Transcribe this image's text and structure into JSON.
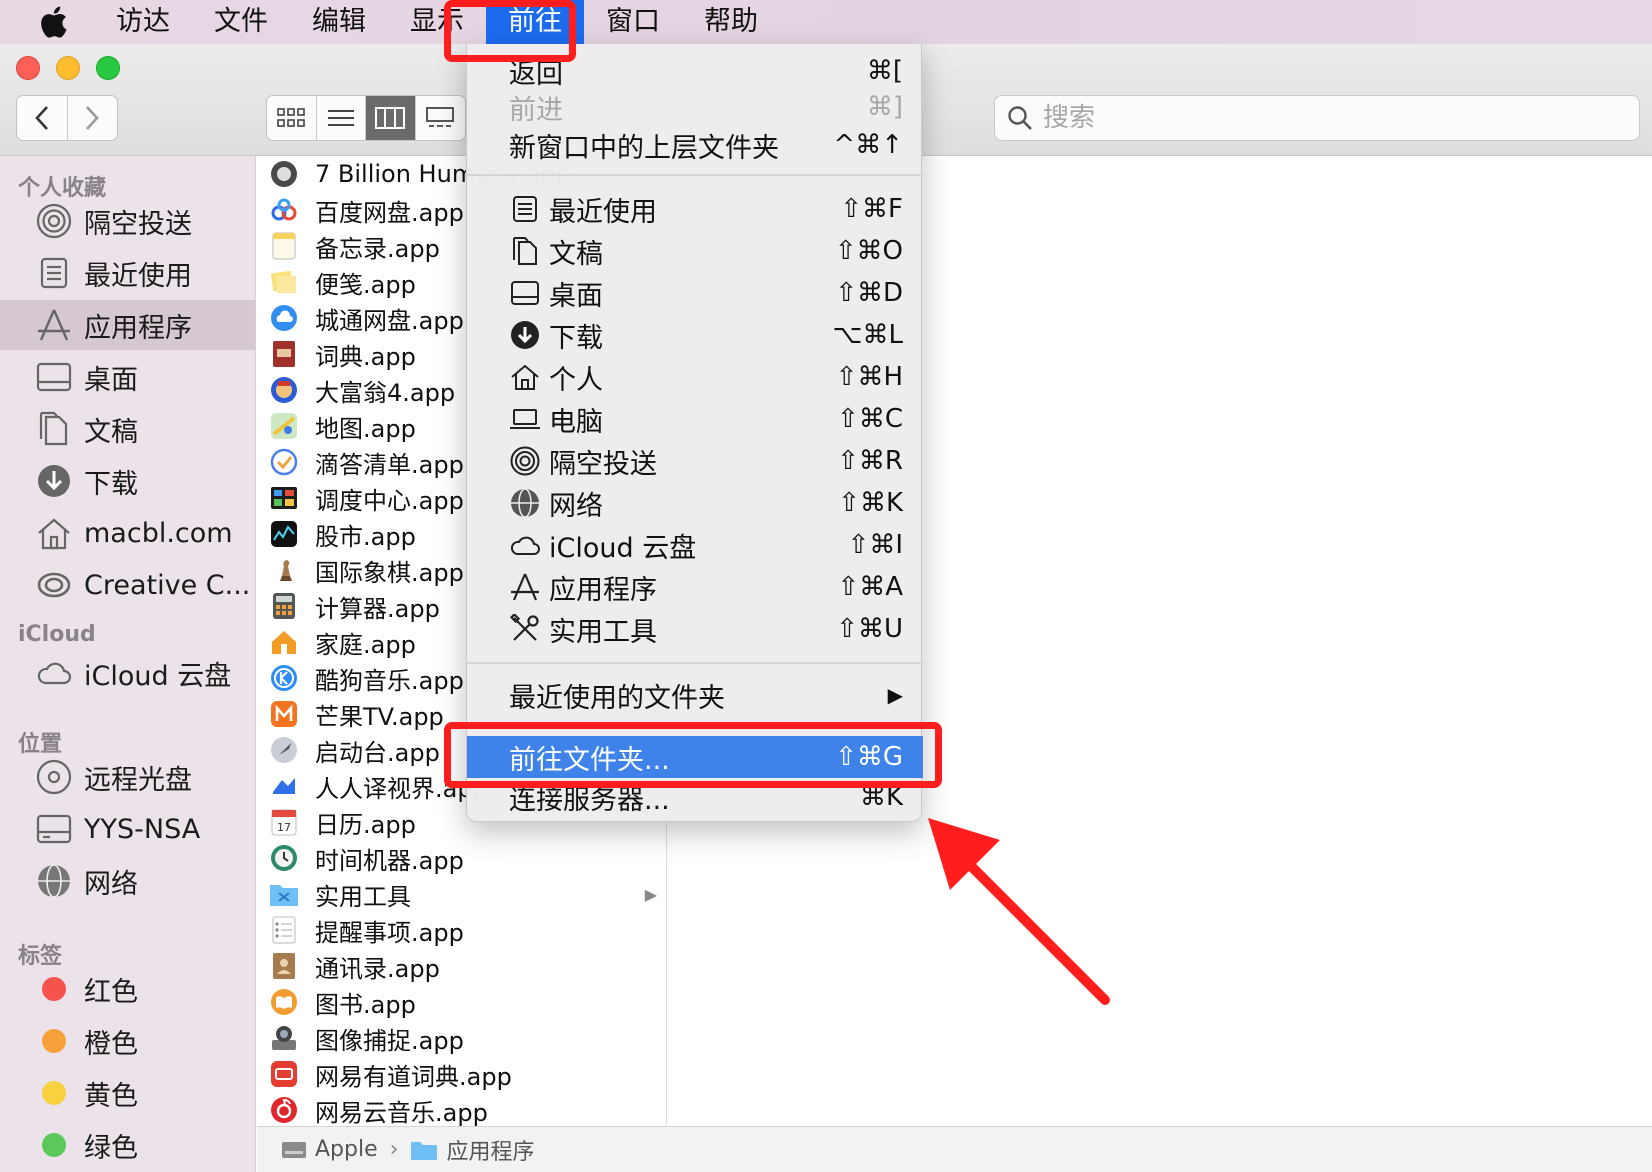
{
  "menubar": {
    "items": [
      "访达",
      "文件",
      "编辑",
      "显示",
      "前往",
      "窗口",
      "帮助"
    ],
    "active": "前往"
  },
  "search": {
    "placeholder": "搜索"
  },
  "sidebar": {
    "favorites_header": "个人收藏",
    "favorites": [
      "隔空投送",
      "最近使用",
      "应用程序",
      "桌面",
      "文稿",
      "下载",
      "macbl.com",
      "Creative C..."
    ],
    "icloud_header": "iCloud",
    "icloud": [
      "iCloud 云盘"
    ],
    "locations_header": "位置",
    "locations": [
      "远程光盘",
      "YYS-NSA",
      "网络"
    ],
    "tags_header": "标签",
    "tags": [
      {
        "label": "红色",
        "color": "#f5534b"
      },
      {
        "label": "橙色",
        "color": "#f7a13b"
      },
      {
        "label": "黄色",
        "color": "#f7d23e"
      },
      {
        "label": "绿色",
        "color": "#5bc85a"
      }
    ]
  },
  "files": [
    "7 Billion Humans.app",
    "百度网盘.app",
    "备忘录.app",
    "便笺.app",
    "城通网盘.app",
    "词典.app",
    "大富翁4.app",
    "地图.app",
    "滴答清单.app",
    "调度中心.app",
    "股市.app",
    "国际象棋.app",
    "计算器.app",
    "家庭.app",
    "酷狗音乐.app",
    "芒果TV.app",
    "启动台.app",
    "人人译视界.app",
    "日历.app",
    "时间机器.app",
    "实用工具",
    "提醒事项.app",
    "通讯录.app",
    "图书.app",
    "图像捕捉.app",
    "网易有道词典.app",
    "网易云音乐.app"
  ],
  "pathbar": {
    "root": "Apple",
    "sep": "›",
    "current": "应用程序"
  },
  "go_menu": {
    "back": {
      "label": "返回",
      "shortcut": "⌘["
    },
    "forward": {
      "label": "前进",
      "shortcut": "⌘]"
    },
    "enclosing": {
      "label": "新窗口中的上层文件夹",
      "shortcut": "^⌘↑"
    },
    "places": [
      {
        "label": "最近使用",
        "shortcut": "⇧⌘F",
        "icon": "recents-icon"
      },
      {
        "label": "文稿",
        "shortcut": "⇧⌘O",
        "icon": "documents-icon"
      },
      {
        "label": "桌面",
        "shortcut": "⇧⌘D",
        "icon": "desktop-icon"
      },
      {
        "label": "下载",
        "shortcut": "⌥⌘L",
        "icon": "downloads-icon"
      },
      {
        "label": "个人",
        "shortcut": "⇧⌘H",
        "icon": "home-icon"
      },
      {
        "label": "电脑",
        "shortcut": "⇧⌘C",
        "icon": "computer-icon"
      },
      {
        "label": "隔空投送",
        "shortcut": "⇧⌘R",
        "icon": "airdrop-icon"
      },
      {
        "label": "网络",
        "shortcut": "⇧⌘K",
        "icon": "network-icon"
      },
      {
        "label": "iCloud 云盘",
        "shortcut": "⇧⌘I",
        "icon": "cloud-icon"
      },
      {
        "label": "应用程序",
        "shortcut": "⇧⌘A",
        "icon": "applications-icon"
      },
      {
        "label": "实用工具",
        "shortcut": "⇧⌘U",
        "icon": "utilities-icon"
      }
    ],
    "recent_folders": {
      "label": "最近使用的文件夹",
      "shortcut": "▶"
    },
    "go_to_folder": {
      "label": "前往文件夹...",
      "shortcut": "⇧⌘G"
    },
    "connect_server": {
      "label": "连接服务器...",
      "shortcut": "⌘K"
    }
  },
  "colors": {
    "highlight": "#3f83ea",
    "annotation": "#ff1d1d",
    "menu_active": "#1d6cf0"
  }
}
